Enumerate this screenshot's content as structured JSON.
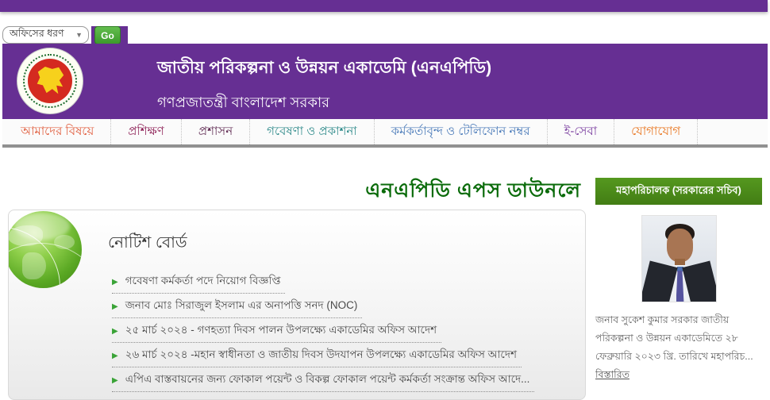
{
  "filter_bar": {
    "office_type_select": {
      "value": "অফিসের ধরণ"
    },
    "go_button_label": "Go"
  },
  "header": {
    "title": "জাতীয় পরিকল্পনা ও উন্নয়ন একাডেমি (এনএপিডি)",
    "subtitle": "গণপ্রজাতন্ত্রী বাংলাদেশ সরকার",
    "logo": "bangladesh-government-seal"
  },
  "nav": {
    "items": [
      {
        "label": "আমাদের বিষয়ে",
        "color": "#e05a3a"
      },
      {
        "label": "প্রশিক্ষণ",
        "color": "#8e2157"
      },
      {
        "label": "প্রশাসন",
        "color": "#5f2a52"
      },
      {
        "label": "গবেষণা ও প্রকাশনা",
        "color": "#2e8a8a"
      },
      {
        "label": "কর্মকর্তাবৃন্দ ও টেলিফোন নম্বর",
        "color": "#4879b8"
      },
      {
        "label": "ই-সেবা",
        "color": "#7b3fa0"
      },
      {
        "label": "যোগাযোগ",
        "color": "#e8731c"
      }
    ]
  },
  "main": {
    "marquee_text": "এনএপিডি এপস ডাউনলে"
  },
  "notice_board": {
    "title": "নোটিশ বোর্ড",
    "bullet_icon": "▶",
    "items": [
      "গবেষণা কর্মকর্তা পদে নিয়োগ বিজ্ঞপ্তি",
      "জনাব মোঃ সিরাজুল ইসলাম এর অনাপত্তি সনদ (NOC)",
      "২৫ মার্চ ২০২৪ - গণহত্যা দিবস পালন উপলক্ষ্যে একাডেমির অফিস আদেশ",
      "২৬ মার্চ ২০২৪ -মহান স্বাধীনতা ও জাতীয় দিবস উদযাপন উপলক্ষ্যে একাডেমির অফিস আদেশ",
      "এপিএ বাস্তবায়নের জন্য ফোকাল পয়েন্ট ও বিকল্প ফোকাল পয়েন্ট কর্মকর্তা সংক্রান্ত অফিস আদে..."
    ]
  },
  "dg_panel": {
    "badge": "মহাপরিচালক (সরকারের সচিব)",
    "photo": "dg-portrait-photo",
    "bio": "জনাব সুকেশ কুমার সরকার জাতীয় পরিকল্পনা ও উন্নয়ন একাডেমিতে ২৮ ফেব্রুয়ারি ২০২৩ খ্রি. তারিখে মহাপরিচ...",
    "details_link": "বিস্তারিত"
  },
  "colors": {
    "primary_purple": "#662f93",
    "go_green": "#3c9a2c",
    "badge_green": "#427d14",
    "marquee_green": "#0a6b0a",
    "nav_divider_gray": "#919191"
  },
  "select_caret_icon": "▼"
}
